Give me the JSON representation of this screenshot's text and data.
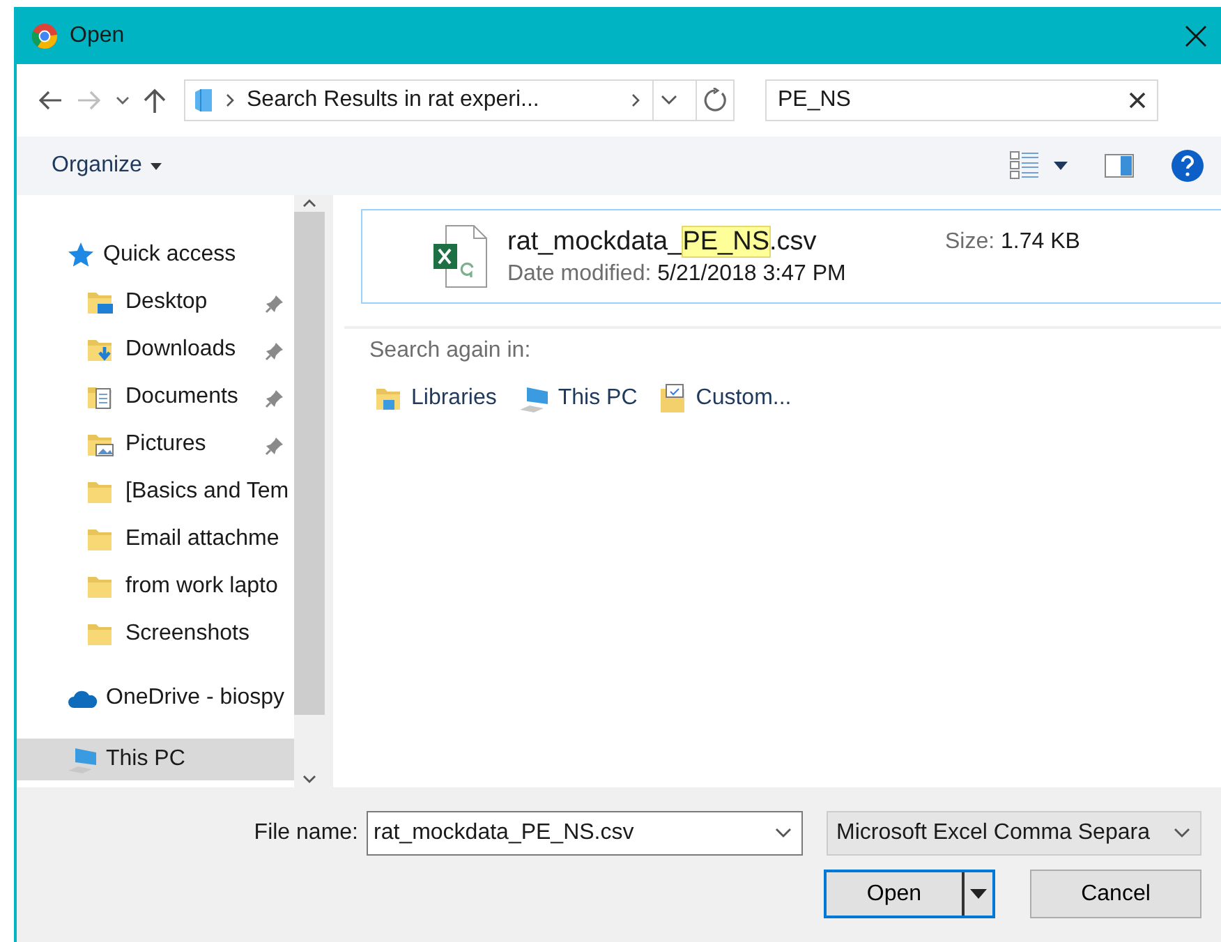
{
  "window": {
    "title": "Open"
  },
  "nav": {
    "back_disabled": false,
    "forward_disabled": true,
    "address": "Search Results in rat experi...",
    "search": {
      "value": "PE_NS"
    }
  },
  "toolbar": {
    "organize": "Organize"
  },
  "sidebar": {
    "items": [
      {
        "label": "Quick access",
        "kind": "quick",
        "pinned": false,
        "selected": false
      },
      {
        "label": "Desktop",
        "kind": "desktop",
        "pinned": true,
        "selected": false
      },
      {
        "label": "Downloads",
        "kind": "downloads",
        "pinned": true,
        "selected": false
      },
      {
        "label": "Documents",
        "kind": "documents",
        "pinned": true,
        "selected": false
      },
      {
        "label": "Pictures",
        "kind": "pictures",
        "pinned": true,
        "selected": false
      },
      {
        "label": "[Basics and Tem",
        "kind": "folder",
        "pinned": false,
        "selected": false
      },
      {
        "label": "Email attachme",
        "kind": "folder",
        "pinned": false,
        "selected": false
      },
      {
        "label": "from work lapto",
        "kind": "folder",
        "pinned": false,
        "selected": false
      },
      {
        "label": "Screenshots",
        "kind": "folder",
        "pinned": false,
        "selected": false
      },
      {
        "label": "OneDrive - biospy",
        "kind": "onedrive",
        "pinned": false,
        "selected": false
      },
      {
        "label": "This PC",
        "kind": "pc",
        "pinned": false,
        "selected": true
      }
    ]
  },
  "results": [
    {
      "name_parts": [
        {
          "text": "rat_mockdata_",
          "highlighted": false
        },
        {
          "text": "PE_NS",
          "highlighted": true
        },
        {
          "text": ".csv",
          "highlighted": false
        }
      ],
      "date_label": "Date modified:",
      "date": "5/21/2018 3:47 PM",
      "size_label": "Size:",
      "size": "1.74 KB"
    }
  ],
  "search_again": {
    "label": "Search again in:",
    "links": [
      {
        "label": "Libraries",
        "kind": "libraries"
      },
      {
        "label": "This PC",
        "kind": "pc"
      },
      {
        "label": "Custom...",
        "kind": "custom"
      }
    ]
  },
  "footer": {
    "file_name_label": "File name:",
    "file_name": "rat_mockdata_PE_NS.csv",
    "file_type": "Microsoft Excel Comma Separa",
    "open": "Open",
    "cancel": "Cancel"
  }
}
